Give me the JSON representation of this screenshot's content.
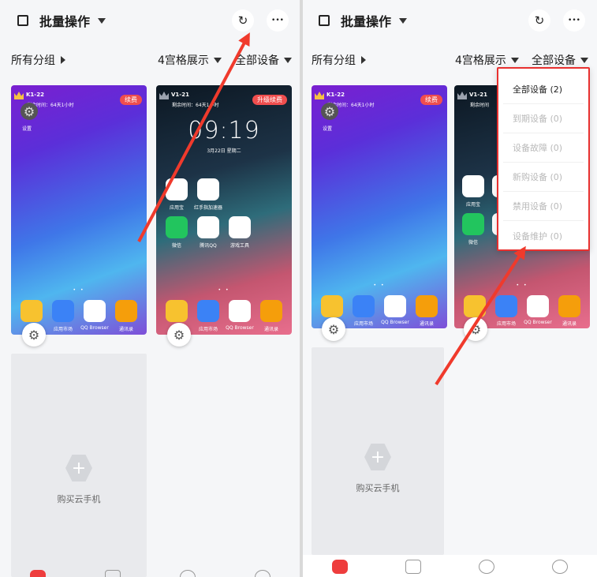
{
  "left": {
    "header": {
      "batch_label": "批量操作"
    },
    "filters": {
      "group": "所有分组",
      "layout": "4宫格展示",
      "devices": "全部设备"
    },
    "phone1": {
      "device": "K1-22",
      "badge": "KING",
      "remaining": "剩余时间：64天1小时",
      "renew": "续费",
      "gear_label": "设置",
      "apps": [
        {
          "label": "",
          "color": "#f7c22f"
        },
        {
          "label": "应用市场",
          "color": "#3b82f6"
        },
        {
          "label": "QQ Browser",
          "color": "#2e8cf0"
        },
        {
          "label": "通讯录",
          "color": "#f59e0b"
        }
      ]
    },
    "phone2": {
      "device": "V1-21",
      "badge": "VIP",
      "remaining": "剩余时间：64天1小时",
      "renew": "升级续费",
      "time": "09:19",
      "date": "3月22日 星期二",
      "apps": [
        {
          "label": "应用宝",
          "color": "#ffffff"
        },
        {
          "label": "红手指加速器",
          "color": "#ffffff"
        },
        {
          "label": "微信",
          "color": "#22c55e"
        },
        {
          "label": "腾讯QQ",
          "color": "#ffffff"
        },
        {
          "label": "游戏工具",
          "color": "#ffffff"
        },
        {
          "label": "",
          "color": "#f7c22f"
        },
        {
          "label": "应用市场",
          "color": "#3b82f6"
        },
        {
          "label": "QQ Browser",
          "color": "#2e8cf0"
        },
        {
          "label": "通讯录",
          "color": "#f59e0b"
        }
      ]
    },
    "buy_label": "购买云手机"
  },
  "right": {
    "header": {
      "batch_label": "批量操作"
    },
    "filters": {
      "group": "所有分组",
      "layout": "4宫格展示",
      "devices": "全部设备"
    },
    "phone1": {
      "device": "K1-22",
      "badge": "KING",
      "remaining": "剩余时间：64天1小时",
      "renew": "续费",
      "gear_label": "设置",
      "apps": [
        {
          "label": "",
          "color": "#f7c22f"
        },
        {
          "label": "应用市场",
          "color": "#3b82f6"
        },
        {
          "label": "QQ Browser",
          "color": "#2e8cf0"
        },
        {
          "label": "通讯录",
          "color": "#f59e0b"
        }
      ]
    },
    "phone2": {
      "device": "V1-21",
      "badge": "VIP",
      "remaining": "剩余时间",
      "apps": [
        {
          "label": "应用宝",
          "color": "#ffffff"
        },
        {
          "label": "红",
          "color": "#ffffff"
        },
        {
          "label": "微信",
          "color": "#22c55e"
        },
        {
          "label": "",
          "color": "#ffffff"
        },
        {
          "label": "",
          "color": "#f7c22f"
        },
        {
          "label": "应用市场",
          "color": "#3b82f6"
        },
        {
          "label": "QQ Browser",
          "color": "#2e8cf0"
        },
        {
          "label": "通讯录",
          "color": "#f59e0b"
        }
      ]
    },
    "buy_label": "购买云手机",
    "dropdown": [
      {
        "label": "全部设备 (2)",
        "active": true
      },
      {
        "label": "到期设备 (0)",
        "active": false
      },
      {
        "label": "设备故障 (0)",
        "active": false
      },
      {
        "label": "新购设备 (0)",
        "active": false
      },
      {
        "label": "禁用设备 (0)",
        "active": false
      },
      {
        "label": "设备维护 (0)",
        "active": false
      }
    ]
  },
  "icons": {
    "refresh": "↻",
    "more": "•••",
    "settings": "⚙",
    "plus": "+"
  },
  "colors": {
    "accent": "#f03a2c",
    "renew": "#f04e4e"
  }
}
